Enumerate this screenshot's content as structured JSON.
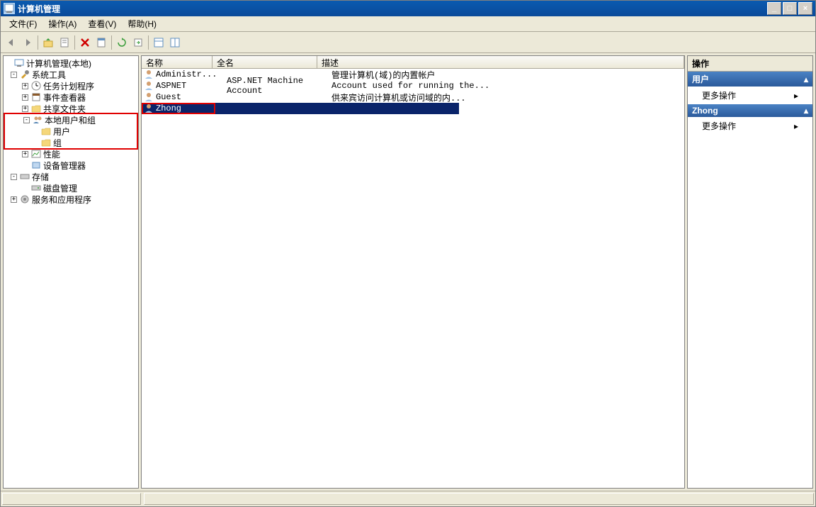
{
  "window": {
    "title": "计算机管理"
  },
  "menu": {
    "file": "文件(F)",
    "action": "操作(A)",
    "view": "查看(V)",
    "help": "帮助(H)"
  },
  "tree": {
    "root": "计算机管理(本地)",
    "system_tools": "系统工具",
    "task_scheduler": "任务计划程序",
    "event_viewer": "事件查看器",
    "shared_folders": "共享文件夹",
    "local_users_groups": "本地用户和组",
    "users": "用户",
    "groups": "组",
    "performance": "性能",
    "device_manager": "设备管理器",
    "storage": "存储",
    "disk_management": "磁盘管理",
    "services_apps": "服务和应用程序"
  },
  "list": {
    "columns": {
      "name": "名称",
      "fullname": "全名",
      "desc": "描述"
    },
    "rows": [
      {
        "name": "Administr...",
        "fullname": "",
        "desc": "管理计算机(域)的内置帐户"
      },
      {
        "name": "ASPNET",
        "fullname": "ASP.NET Machine Account",
        "desc": "Account used for running the..."
      },
      {
        "name": "Guest",
        "fullname": "",
        "desc": "供来宾访问计算机或访问域的内..."
      },
      {
        "name": "Zhong",
        "fullname": "",
        "desc": ""
      }
    ]
  },
  "actions": {
    "title": "操作",
    "section1": "用户",
    "more1": "更多操作",
    "section2": "Zhong",
    "more2": "更多操作"
  }
}
